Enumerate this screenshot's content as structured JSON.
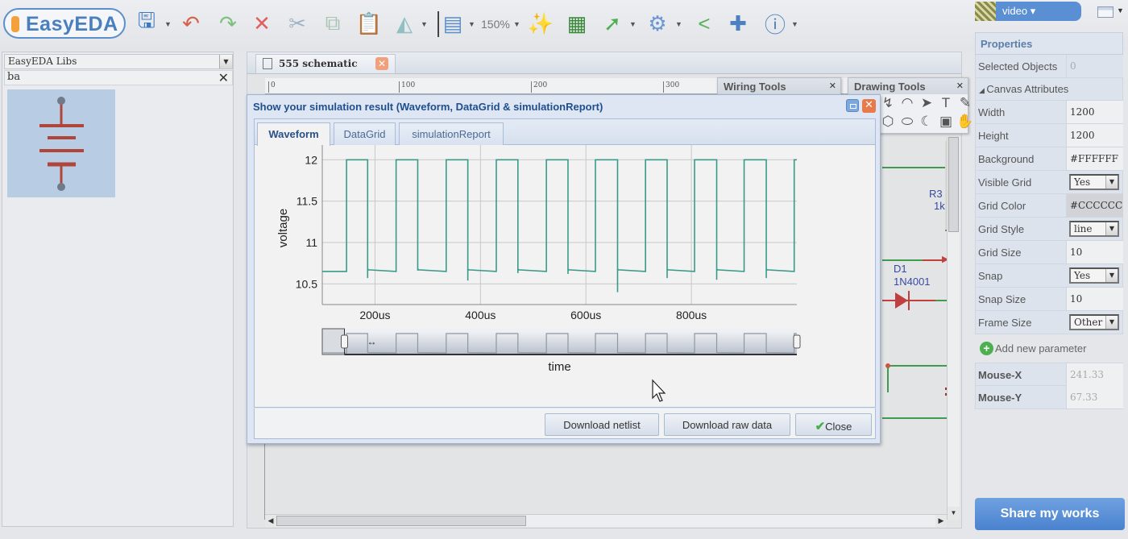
{
  "app": {
    "logo_text": "EasyEDA"
  },
  "toolbar": {
    "icons": [
      {
        "name": "save-icon",
        "glyph": "🖫",
        "color": "#3b79c2"
      },
      {
        "name": "undo-icon",
        "glyph": "↶",
        "color": "#d7604a"
      },
      {
        "name": "redo-icon",
        "glyph": "↷",
        "color": "#7cc07c"
      },
      {
        "name": "delete-icon",
        "glyph": "✕",
        "color": "#e06060"
      },
      {
        "name": "cut-icon",
        "glyph": "✂",
        "color": "#9fb3c6"
      },
      {
        "name": "copy-icon",
        "glyph": "⧉",
        "color": "#a9c2b2"
      },
      {
        "name": "paste-icon",
        "glyph": "📋",
        "color": "#5a84c4"
      },
      {
        "name": "rotate-icon",
        "glyph": "◭",
        "color": "#8fc0c4"
      },
      {
        "name": "align-icon",
        "glyph": "▤",
        "color": "#5b8fc9"
      },
      {
        "name": "magic-wand-icon",
        "glyph": "✨",
        "color": "#e0b020"
      },
      {
        "name": "pcb-icon",
        "glyph": "▦",
        "color": "#3a8a3a"
      },
      {
        "name": "simulate-icon",
        "glyph": "➚",
        "color": "#4caf50"
      },
      {
        "name": "settings-gear-icon",
        "glyph": "⚙",
        "color": "#6a96d8"
      },
      {
        "name": "share-icon",
        "glyph": "<",
        "color": "#58b058"
      },
      {
        "name": "plugin-puzzle-icon",
        "glyph": "✚",
        "color": "#4d80c0"
      },
      {
        "name": "info-icon",
        "glyph": "ⓘ",
        "color": "#4a7fbe"
      }
    ],
    "zoom_level": "150%",
    "user_menu_label": "video ▾"
  },
  "library": {
    "source": "EasyEDA Libs",
    "search_value": "ba",
    "result_symbol": "battery"
  },
  "document_tab": {
    "title": "555 schematic"
  },
  "ruler": {
    "labels": [
      "0",
      "100",
      "200",
      "300"
    ]
  },
  "wiring_tools": {
    "title": "Wiring Tools"
  },
  "drawing_tools": {
    "title": "Drawing Tools",
    "tools": [
      {
        "name": "bezier-tool-icon",
        "glyph": "↯"
      },
      {
        "name": "arc-tool-icon",
        "glyph": "◠"
      },
      {
        "name": "arrow-tool-icon",
        "glyph": "➤"
      },
      {
        "name": "text-tool-icon",
        "glyph": "T"
      },
      {
        "name": "pencil-tool-icon",
        "glyph": "✎"
      },
      {
        "name": "polygon-tool-icon",
        "glyph": "⬡"
      },
      {
        "name": "ellipse-tool-icon",
        "glyph": "⬭"
      },
      {
        "name": "pie-tool-icon",
        "glyph": "☾"
      },
      {
        "name": "image-tool-icon",
        "glyph": "▣"
      },
      {
        "name": "pan-hand-tool-icon",
        "glyph": "✋"
      }
    ]
  },
  "simulation_dialog": {
    "title": "Show your simulation result (Waveform, DataGrid & simulationReport)",
    "tabs": [
      "Waveform",
      "DataGrid",
      "simulationReport"
    ],
    "active_tab": "Waveform",
    "buttons": {
      "download_netlist": "Download netlist",
      "download_raw": "Download raw data",
      "close": "Close"
    }
  },
  "chart_data": {
    "type": "line",
    "title": "",
    "xlabel": "time",
    "ylabel": "voltage",
    "xlim": [
      100,
      1000
    ],
    "ylim": [
      10.25,
      12.1
    ],
    "x_unit": "us",
    "x_ticks": [
      200,
      400,
      600,
      800
    ],
    "x_tick_labels": [
      "200us",
      "400us",
      "600us",
      "800us"
    ],
    "y_ticks": [
      10.5,
      11,
      11.5,
      12
    ],
    "y_tick_labels": [
      "10.5",
      "11",
      "11.5",
      "12"
    ],
    "grid": true,
    "series": [
      {
        "name": "voltage",
        "color": "#3a9a8a",
        "high": 12,
        "low": 10.65,
        "rising_edges_us": [
          146,
          240,
          335,
          430,
          525,
          618,
          713,
          806,
          900,
          995
        ],
        "falling_edges_us": [
          186,
          281,
          376,
          471,
          566,
          660,
          754,
          848,
          942
        ],
        "falling_undershoot_v": [
          10.57,
          10.66,
          10.54,
          10.63,
          10.62,
          10.4,
          10.57,
          10.55,
          10.57
        ]
      }
    ],
    "navigator": {
      "selected_range_us": [
        240,
        1000
      ]
    }
  },
  "schematic": {
    "r3_label": "R3",
    "r3_value": "1k",
    "d1_label": "D1",
    "d1_value": "1N4001"
  },
  "properties": {
    "header": "Properties",
    "selected_objects_label": "Selected Objects",
    "selected_objects_value": "0",
    "section": "Canvas Attributes",
    "rows": [
      {
        "key": "Width",
        "value": "1200",
        "kind": "text"
      },
      {
        "key": "Height",
        "value": "1200",
        "kind": "text"
      },
      {
        "key": "Background",
        "value": "#FFFFFF",
        "kind": "text"
      },
      {
        "key": "Visible Grid",
        "value": "Yes",
        "kind": "select"
      },
      {
        "key": "Grid Color",
        "value": "#CCCCCC",
        "kind": "color"
      },
      {
        "key": "Grid Style",
        "value": "line",
        "kind": "select"
      },
      {
        "key": "Grid Size",
        "value": "10",
        "kind": "text"
      },
      {
        "key": "Snap",
        "value": "Yes",
        "kind": "select"
      },
      {
        "key": "Snap Size",
        "value": "10",
        "kind": "text"
      },
      {
        "key": "Frame Size",
        "value": "Other",
        "kind": "select"
      }
    ],
    "add_param_label": "Add new parameter",
    "mouse_x_label": "Mouse-X",
    "mouse_x_value": "241.33",
    "mouse_y_label": "Mouse-Y",
    "mouse_y_value": "67.33",
    "share_label": "Share my works"
  }
}
